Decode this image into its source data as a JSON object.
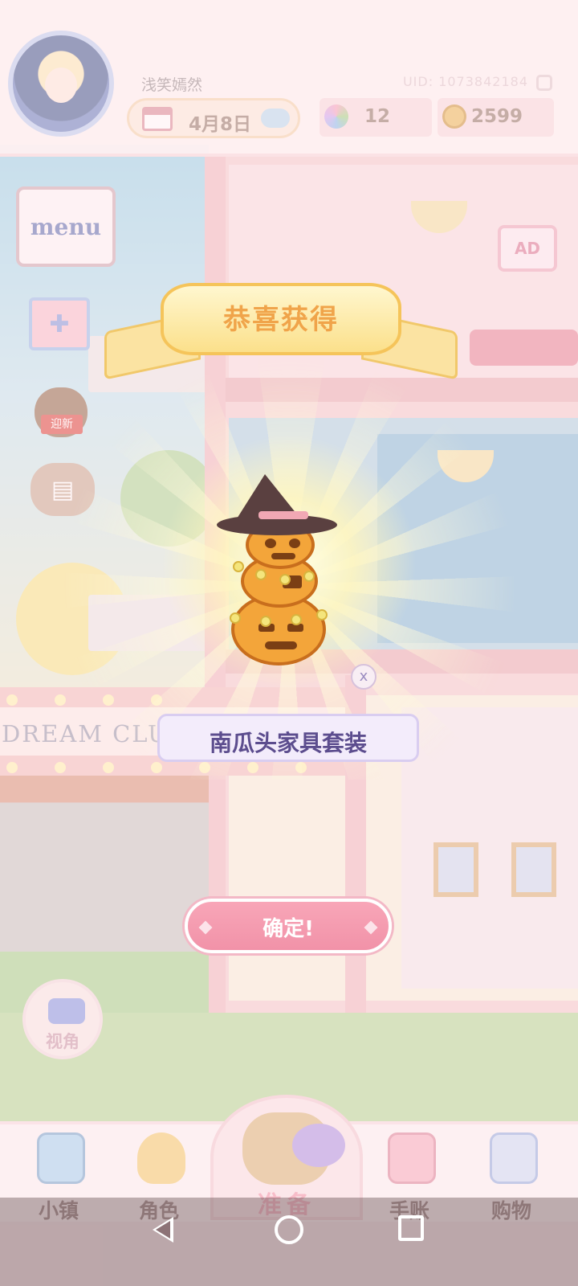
{
  "header": {
    "username": "浅笑嫣然",
    "uid": "UID: 1073842184",
    "date": "4月8日",
    "gems": "12",
    "coins": "2599"
  },
  "side_menu": {
    "menu_label": "menu",
    "newyear_label": "迎新",
    "ad_label": "AD",
    "view_label": "视角"
  },
  "scene": {
    "club_sign": "DREAM CLUB"
  },
  "reward_popup": {
    "title": "恭喜获得",
    "item_name": "南瓜头家具套装",
    "close_glyph": "x",
    "confirm_label": "确定!"
  },
  "bottom_nav": {
    "items": [
      {
        "label": "小镇",
        "icon": "map-icon"
      },
      {
        "label": "角色",
        "icon": "character-icon"
      },
      {
        "label": "准备",
        "icon": "basket-icon"
      },
      {
        "label": "手账",
        "icon": "journal-icon"
      },
      {
        "label": "购物",
        "icon": "shopping-bag-icon"
      }
    ]
  },
  "colors": {
    "accent_pink": "#f192a8",
    "banner_gold": "#f0a44a",
    "item_name_purple": "#5c4d8e"
  }
}
